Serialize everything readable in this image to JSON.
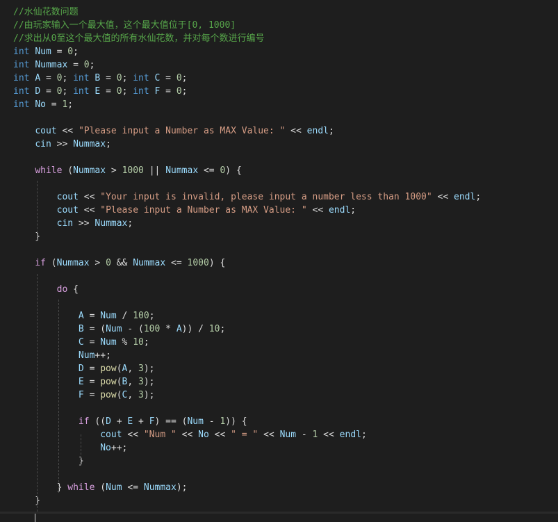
{
  "editor": {
    "language": "C++",
    "theme_colors": {
      "background": "#1e1e1e",
      "comment": "#57a64a",
      "keyword": "#569cd6",
      "control": "#d8a0df",
      "string": "#d69d85",
      "number": "#b5cea8",
      "variable": "#9cdcfe",
      "function": "#dcdcaa",
      "plain": "#dcdcdc"
    },
    "lines": [
      {
        "tokens": [
          {
            "t": "comment",
            "v": "//水仙花数问题"
          }
        ]
      },
      {
        "tokens": [
          {
            "t": "comment",
            "v": "//由玩家输入一个最大值，这个最大值位于[0, 1000]"
          }
        ]
      },
      {
        "tokens": [
          {
            "t": "comment",
            "v": "//求出从0至这个最大值的所有水仙花数，并对每个数进行编号"
          }
        ]
      },
      {
        "tokens": [
          {
            "t": "keyword",
            "v": "int"
          },
          {
            "t": "plain",
            "v": " "
          },
          {
            "t": "variable",
            "v": "Num"
          },
          {
            "t": "plain",
            "v": " = "
          },
          {
            "t": "number",
            "v": "0"
          },
          {
            "t": "plain",
            "v": ";"
          }
        ]
      },
      {
        "tokens": [
          {
            "t": "keyword",
            "v": "int"
          },
          {
            "t": "plain",
            "v": " "
          },
          {
            "t": "variable",
            "v": "Nummax"
          },
          {
            "t": "plain",
            "v": " = "
          },
          {
            "t": "number",
            "v": "0"
          },
          {
            "t": "plain",
            "v": ";"
          }
        ]
      },
      {
        "tokens": [
          {
            "t": "keyword",
            "v": "int"
          },
          {
            "t": "plain",
            "v": " "
          },
          {
            "t": "variable",
            "v": "A"
          },
          {
            "t": "plain",
            "v": " = "
          },
          {
            "t": "number",
            "v": "0"
          },
          {
            "t": "plain",
            "v": "; "
          },
          {
            "t": "keyword",
            "v": "int"
          },
          {
            "t": "plain",
            "v": " "
          },
          {
            "t": "variable",
            "v": "B"
          },
          {
            "t": "plain",
            "v": " = "
          },
          {
            "t": "number",
            "v": "0"
          },
          {
            "t": "plain",
            "v": "; "
          },
          {
            "t": "keyword",
            "v": "int"
          },
          {
            "t": "plain",
            "v": " "
          },
          {
            "t": "variable",
            "v": "C"
          },
          {
            "t": "plain",
            "v": " = "
          },
          {
            "t": "number",
            "v": "0"
          },
          {
            "t": "plain",
            "v": ";"
          }
        ]
      },
      {
        "tokens": [
          {
            "t": "keyword",
            "v": "int"
          },
          {
            "t": "plain",
            "v": " "
          },
          {
            "t": "variable",
            "v": "D"
          },
          {
            "t": "plain",
            "v": " = "
          },
          {
            "t": "number",
            "v": "0"
          },
          {
            "t": "plain",
            "v": "; "
          },
          {
            "t": "keyword",
            "v": "int"
          },
          {
            "t": "plain",
            "v": " "
          },
          {
            "t": "variable",
            "v": "E"
          },
          {
            "t": "plain",
            "v": " = "
          },
          {
            "t": "number",
            "v": "0"
          },
          {
            "t": "plain",
            "v": "; "
          },
          {
            "t": "keyword",
            "v": "int"
          },
          {
            "t": "plain",
            "v": " "
          },
          {
            "t": "variable",
            "v": "F"
          },
          {
            "t": "plain",
            "v": " = "
          },
          {
            "t": "number",
            "v": "0"
          },
          {
            "t": "plain",
            "v": ";"
          }
        ]
      },
      {
        "tokens": [
          {
            "t": "keyword",
            "v": "int"
          },
          {
            "t": "plain",
            "v": " "
          },
          {
            "t": "variable",
            "v": "No"
          },
          {
            "t": "plain",
            "v": " = "
          },
          {
            "t": "number",
            "v": "1"
          },
          {
            "t": "plain",
            "v": ";"
          }
        ]
      },
      {
        "tokens": []
      },
      {
        "tokens": [
          {
            "t": "plain",
            "v": "    "
          },
          {
            "t": "variable",
            "v": "cout"
          },
          {
            "t": "plain",
            "v": " << "
          },
          {
            "t": "string",
            "v": "\"Please input a Number as MAX Value: \""
          },
          {
            "t": "plain",
            "v": " << "
          },
          {
            "t": "variable",
            "v": "endl"
          },
          {
            "t": "plain",
            "v": ";"
          }
        ]
      },
      {
        "tokens": [
          {
            "t": "plain",
            "v": "    "
          },
          {
            "t": "variable",
            "v": "cin"
          },
          {
            "t": "plain",
            "v": " >> "
          },
          {
            "t": "variable",
            "v": "Nummax"
          },
          {
            "t": "plain",
            "v": ";"
          }
        ]
      },
      {
        "tokens": []
      },
      {
        "tokens": [
          {
            "t": "plain",
            "v": "    "
          },
          {
            "t": "control",
            "v": "while"
          },
          {
            "t": "plain",
            "v": " ("
          },
          {
            "t": "variable",
            "v": "Nummax"
          },
          {
            "t": "plain",
            "v": " > "
          },
          {
            "t": "number",
            "v": "1000"
          },
          {
            "t": "plain",
            "v": " || "
          },
          {
            "t": "variable",
            "v": "Nummax"
          },
          {
            "t": "plain",
            "v": " <= "
          },
          {
            "t": "number",
            "v": "0"
          },
          {
            "t": "plain",
            "v": ") {"
          }
        ]
      },
      {
        "tokens": []
      },
      {
        "tokens": [
          {
            "t": "plain",
            "v": "        "
          },
          {
            "t": "variable",
            "v": "cout"
          },
          {
            "t": "plain",
            "v": " << "
          },
          {
            "t": "string",
            "v": "\"Your input is invalid, please input a number less than 1000\""
          },
          {
            "t": "plain",
            "v": " << "
          },
          {
            "t": "variable",
            "v": "endl"
          },
          {
            "t": "plain",
            "v": ";"
          }
        ]
      },
      {
        "tokens": [
          {
            "t": "plain",
            "v": "        "
          },
          {
            "t": "variable",
            "v": "cout"
          },
          {
            "t": "plain",
            "v": " << "
          },
          {
            "t": "string",
            "v": "\"Please input a Number as MAX Value: \""
          },
          {
            "t": "plain",
            "v": " << "
          },
          {
            "t": "variable",
            "v": "endl"
          },
          {
            "t": "plain",
            "v": ";"
          }
        ]
      },
      {
        "tokens": [
          {
            "t": "plain",
            "v": "        "
          },
          {
            "t": "variable",
            "v": "cin"
          },
          {
            "t": "plain",
            "v": " >> "
          },
          {
            "t": "variable",
            "v": "Nummax"
          },
          {
            "t": "plain",
            "v": ";"
          }
        ]
      },
      {
        "tokens": [
          {
            "t": "plain",
            "v": "    }"
          }
        ]
      },
      {
        "tokens": []
      },
      {
        "tokens": [
          {
            "t": "plain",
            "v": "    "
          },
          {
            "t": "control",
            "v": "if"
          },
          {
            "t": "plain",
            "v": " ("
          },
          {
            "t": "variable",
            "v": "Nummax"
          },
          {
            "t": "plain",
            "v": " > "
          },
          {
            "t": "number",
            "v": "0"
          },
          {
            "t": "plain",
            "v": " && "
          },
          {
            "t": "variable",
            "v": "Nummax"
          },
          {
            "t": "plain",
            "v": " <= "
          },
          {
            "t": "number",
            "v": "1000"
          },
          {
            "t": "plain",
            "v": ") {"
          }
        ]
      },
      {
        "tokens": []
      },
      {
        "tokens": [
          {
            "t": "plain",
            "v": "        "
          },
          {
            "t": "control",
            "v": "do"
          },
          {
            "t": "plain",
            "v": " {"
          }
        ]
      },
      {
        "tokens": []
      },
      {
        "tokens": [
          {
            "t": "plain",
            "v": "            "
          },
          {
            "t": "variable",
            "v": "A"
          },
          {
            "t": "plain",
            "v": " = "
          },
          {
            "t": "variable",
            "v": "Num"
          },
          {
            "t": "plain",
            "v": " / "
          },
          {
            "t": "number",
            "v": "100"
          },
          {
            "t": "plain",
            "v": ";"
          }
        ]
      },
      {
        "tokens": [
          {
            "t": "plain",
            "v": "            "
          },
          {
            "t": "variable",
            "v": "B"
          },
          {
            "t": "plain",
            "v": " = ("
          },
          {
            "t": "variable",
            "v": "Num"
          },
          {
            "t": "plain",
            "v": " - ("
          },
          {
            "t": "number",
            "v": "100"
          },
          {
            "t": "plain",
            "v": " * "
          },
          {
            "t": "variable",
            "v": "A"
          },
          {
            "t": "plain",
            "v": ")) / "
          },
          {
            "t": "number",
            "v": "10"
          },
          {
            "t": "plain",
            "v": ";"
          }
        ]
      },
      {
        "tokens": [
          {
            "t": "plain",
            "v": "            "
          },
          {
            "t": "variable",
            "v": "C"
          },
          {
            "t": "plain",
            "v": " = "
          },
          {
            "t": "variable",
            "v": "Num"
          },
          {
            "t": "plain",
            "v": " % "
          },
          {
            "t": "number",
            "v": "10"
          },
          {
            "t": "plain",
            "v": ";"
          }
        ]
      },
      {
        "tokens": [
          {
            "t": "plain",
            "v": "            "
          },
          {
            "t": "variable",
            "v": "Num"
          },
          {
            "t": "plain",
            "v": "++;"
          }
        ]
      },
      {
        "tokens": [
          {
            "t": "plain",
            "v": "            "
          },
          {
            "t": "variable",
            "v": "D"
          },
          {
            "t": "plain",
            "v": " = "
          },
          {
            "t": "func",
            "v": "pow"
          },
          {
            "t": "plain",
            "v": "("
          },
          {
            "t": "variable",
            "v": "A"
          },
          {
            "t": "plain",
            "v": ", "
          },
          {
            "t": "number",
            "v": "3"
          },
          {
            "t": "plain",
            "v": ");"
          }
        ]
      },
      {
        "tokens": [
          {
            "t": "plain",
            "v": "            "
          },
          {
            "t": "variable",
            "v": "E"
          },
          {
            "t": "plain",
            "v": " = "
          },
          {
            "t": "func",
            "v": "pow"
          },
          {
            "t": "plain",
            "v": "("
          },
          {
            "t": "variable",
            "v": "B"
          },
          {
            "t": "plain",
            "v": ", "
          },
          {
            "t": "number",
            "v": "3"
          },
          {
            "t": "plain",
            "v": ");"
          }
        ]
      },
      {
        "tokens": [
          {
            "t": "plain",
            "v": "            "
          },
          {
            "t": "variable",
            "v": "F"
          },
          {
            "t": "plain",
            "v": " = "
          },
          {
            "t": "func",
            "v": "pow"
          },
          {
            "t": "plain",
            "v": "("
          },
          {
            "t": "variable",
            "v": "C"
          },
          {
            "t": "plain",
            "v": ", "
          },
          {
            "t": "number",
            "v": "3"
          },
          {
            "t": "plain",
            "v": ");"
          }
        ]
      },
      {
        "tokens": []
      },
      {
        "tokens": [
          {
            "t": "plain",
            "v": "            "
          },
          {
            "t": "control",
            "v": "if"
          },
          {
            "t": "plain",
            "v": " (("
          },
          {
            "t": "variable",
            "v": "D"
          },
          {
            "t": "plain",
            "v": " + "
          },
          {
            "t": "variable",
            "v": "E"
          },
          {
            "t": "plain",
            "v": " + "
          },
          {
            "t": "variable",
            "v": "F"
          },
          {
            "t": "plain",
            "v": ") == ("
          },
          {
            "t": "variable",
            "v": "Num"
          },
          {
            "t": "plain",
            "v": " - "
          },
          {
            "t": "number",
            "v": "1"
          },
          {
            "t": "plain",
            "v": ")) {"
          }
        ]
      },
      {
        "tokens": [
          {
            "t": "plain",
            "v": "                "
          },
          {
            "t": "variable",
            "v": "cout"
          },
          {
            "t": "plain",
            "v": " << "
          },
          {
            "t": "string",
            "v": "\"Num \""
          },
          {
            "t": "plain",
            "v": " << "
          },
          {
            "t": "variable",
            "v": "No"
          },
          {
            "t": "plain",
            "v": " << "
          },
          {
            "t": "string",
            "v": "\" = \""
          },
          {
            "t": "plain",
            "v": " << "
          },
          {
            "t": "variable",
            "v": "Num"
          },
          {
            "t": "plain",
            "v": " - "
          },
          {
            "t": "number",
            "v": "1"
          },
          {
            "t": "plain",
            "v": " << "
          },
          {
            "t": "variable",
            "v": "endl"
          },
          {
            "t": "plain",
            "v": ";"
          }
        ]
      },
      {
        "tokens": [
          {
            "t": "plain",
            "v": "                "
          },
          {
            "t": "variable",
            "v": "No"
          },
          {
            "t": "plain",
            "v": "++;"
          }
        ]
      },
      {
        "tokens": [
          {
            "t": "plain",
            "v": "            }"
          }
        ]
      },
      {
        "tokens": []
      },
      {
        "tokens": [
          {
            "t": "plain",
            "v": "        } "
          },
          {
            "t": "control",
            "v": "while"
          },
          {
            "t": "plain",
            "v": " ("
          },
          {
            "t": "variable",
            "v": "Num"
          },
          {
            "t": "plain",
            "v": " <= "
          },
          {
            "t": "variable",
            "v": "Nummax"
          },
          {
            "t": "plain",
            "v": ");"
          }
        ]
      },
      {
        "tokens": [
          {
            "t": "plain",
            "v": "    }"
          }
        ]
      }
    ]
  }
}
